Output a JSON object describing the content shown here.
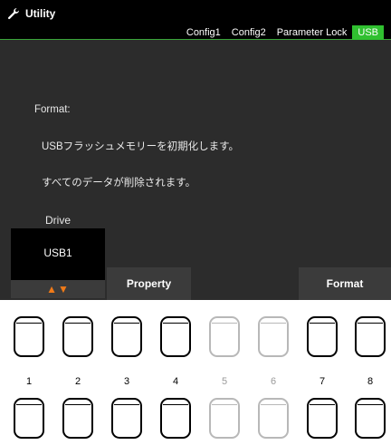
{
  "header": {
    "title": "Utility",
    "icon": "wrench-icon",
    "tabs": [
      {
        "label": "Config1",
        "active": false
      },
      {
        "label": "Config2",
        "active": false
      },
      {
        "label": "Parameter Lock",
        "active": false
      },
      {
        "label": "USB",
        "active": true
      }
    ]
  },
  "message": {
    "line1": "Format:",
    "line2": "USBフラッシュメモリーを初期化します。",
    "line3": "すべてのデータが削除されます。"
  },
  "drive": {
    "label": "Drive",
    "value": "USB1",
    "arrows": "▲▼"
  },
  "buttons": {
    "property": "Property",
    "format": "Format"
  },
  "keys": {
    "numbers": [
      "1",
      "2",
      "3",
      "4",
      "5",
      "6",
      "7",
      "8"
    ],
    "enabled": [
      true,
      true,
      true,
      true,
      false,
      false,
      true,
      true
    ]
  },
  "colors": {
    "accent": "#30c030",
    "arrow": "#f07a18",
    "screen_bg": "#2c2c2c"
  }
}
